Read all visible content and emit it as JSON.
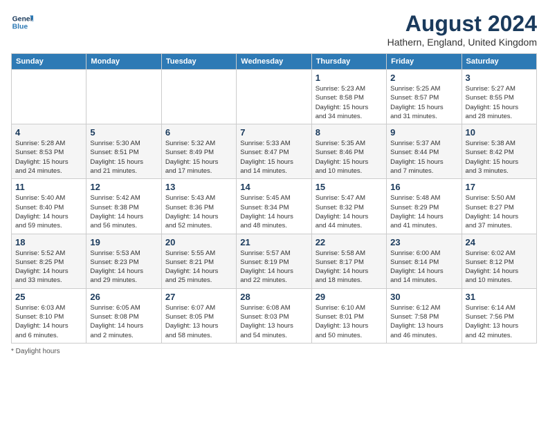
{
  "header": {
    "logo_line1": "General",
    "logo_line2": "Blue",
    "month_title": "August 2024",
    "location": "Hathern, England, United Kingdom"
  },
  "days_of_week": [
    "Sunday",
    "Monday",
    "Tuesday",
    "Wednesday",
    "Thursday",
    "Friday",
    "Saturday"
  ],
  "weeks": [
    [
      {
        "day": "",
        "info": ""
      },
      {
        "day": "",
        "info": ""
      },
      {
        "day": "",
        "info": ""
      },
      {
        "day": "",
        "info": ""
      },
      {
        "day": "1",
        "info": "Sunrise: 5:23 AM\nSunset: 8:58 PM\nDaylight: 15 hours\nand 34 minutes."
      },
      {
        "day": "2",
        "info": "Sunrise: 5:25 AM\nSunset: 8:57 PM\nDaylight: 15 hours\nand 31 minutes."
      },
      {
        "day": "3",
        "info": "Sunrise: 5:27 AM\nSunset: 8:55 PM\nDaylight: 15 hours\nand 28 minutes."
      }
    ],
    [
      {
        "day": "4",
        "info": "Sunrise: 5:28 AM\nSunset: 8:53 PM\nDaylight: 15 hours\nand 24 minutes."
      },
      {
        "day": "5",
        "info": "Sunrise: 5:30 AM\nSunset: 8:51 PM\nDaylight: 15 hours\nand 21 minutes."
      },
      {
        "day": "6",
        "info": "Sunrise: 5:32 AM\nSunset: 8:49 PM\nDaylight: 15 hours\nand 17 minutes."
      },
      {
        "day": "7",
        "info": "Sunrise: 5:33 AM\nSunset: 8:47 PM\nDaylight: 15 hours\nand 14 minutes."
      },
      {
        "day": "8",
        "info": "Sunrise: 5:35 AM\nSunset: 8:46 PM\nDaylight: 15 hours\nand 10 minutes."
      },
      {
        "day": "9",
        "info": "Sunrise: 5:37 AM\nSunset: 8:44 PM\nDaylight: 15 hours\nand 7 minutes."
      },
      {
        "day": "10",
        "info": "Sunrise: 5:38 AM\nSunset: 8:42 PM\nDaylight: 15 hours\nand 3 minutes."
      }
    ],
    [
      {
        "day": "11",
        "info": "Sunrise: 5:40 AM\nSunset: 8:40 PM\nDaylight: 14 hours\nand 59 minutes."
      },
      {
        "day": "12",
        "info": "Sunrise: 5:42 AM\nSunset: 8:38 PM\nDaylight: 14 hours\nand 56 minutes."
      },
      {
        "day": "13",
        "info": "Sunrise: 5:43 AM\nSunset: 8:36 PM\nDaylight: 14 hours\nand 52 minutes."
      },
      {
        "day": "14",
        "info": "Sunrise: 5:45 AM\nSunset: 8:34 PM\nDaylight: 14 hours\nand 48 minutes."
      },
      {
        "day": "15",
        "info": "Sunrise: 5:47 AM\nSunset: 8:32 PM\nDaylight: 14 hours\nand 44 minutes."
      },
      {
        "day": "16",
        "info": "Sunrise: 5:48 AM\nSunset: 8:29 PM\nDaylight: 14 hours\nand 41 minutes."
      },
      {
        "day": "17",
        "info": "Sunrise: 5:50 AM\nSunset: 8:27 PM\nDaylight: 14 hours\nand 37 minutes."
      }
    ],
    [
      {
        "day": "18",
        "info": "Sunrise: 5:52 AM\nSunset: 8:25 PM\nDaylight: 14 hours\nand 33 minutes."
      },
      {
        "day": "19",
        "info": "Sunrise: 5:53 AM\nSunset: 8:23 PM\nDaylight: 14 hours\nand 29 minutes."
      },
      {
        "day": "20",
        "info": "Sunrise: 5:55 AM\nSunset: 8:21 PM\nDaylight: 14 hours\nand 25 minutes."
      },
      {
        "day": "21",
        "info": "Sunrise: 5:57 AM\nSunset: 8:19 PM\nDaylight: 14 hours\nand 22 minutes."
      },
      {
        "day": "22",
        "info": "Sunrise: 5:58 AM\nSunset: 8:17 PM\nDaylight: 14 hours\nand 18 minutes."
      },
      {
        "day": "23",
        "info": "Sunrise: 6:00 AM\nSunset: 8:14 PM\nDaylight: 14 hours\nand 14 minutes."
      },
      {
        "day": "24",
        "info": "Sunrise: 6:02 AM\nSunset: 8:12 PM\nDaylight: 14 hours\nand 10 minutes."
      }
    ],
    [
      {
        "day": "25",
        "info": "Sunrise: 6:03 AM\nSunset: 8:10 PM\nDaylight: 14 hours\nand 6 minutes."
      },
      {
        "day": "26",
        "info": "Sunrise: 6:05 AM\nSunset: 8:08 PM\nDaylight: 14 hours\nand 2 minutes."
      },
      {
        "day": "27",
        "info": "Sunrise: 6:07 AM\nSunset: 8:05 PM\nDaylight: 13 hours\nand 58 minutes."
      },
      {
        "day": "28",
        "info": "Sunrise: 6:08 AM\nSunset: 8:03 PM\nDaylight: 13 hours\nand 54 minutes."
      },
      {
        "day": "29",
        "info": "Sunrise: 6:10 AM\nSunset: 8:01 PM\nDaylight: 13 hours\nand 50 minutes."
      },
      {
        "day": "30",
        "info": "Sunrise: 6:12 AM\nSunset: 7:58 PM\nDaylight: 13 hours\nand 46 minutes."
      },
      {
        "day": "31",
        "info": "Sunrise: 6:14 AM\nSunset: 7:56 PM\nDaylight: 13 hours\nand 42 minutes."
      }
    ]
  ],
  "footer": {
    "note": "Daylight hours"
  }
}
